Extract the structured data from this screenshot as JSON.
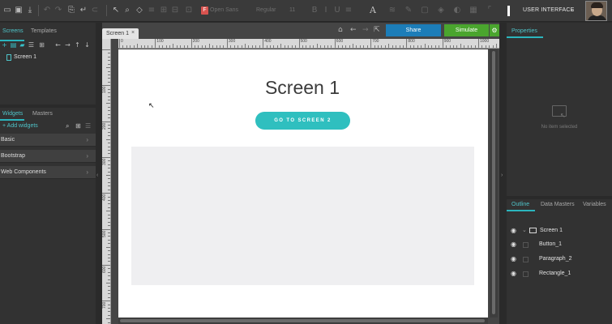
{
  "toolbar": {
    "font_badge": "F",
    "font_family": "Open Sans",
    "font_style": "Regular",
    "font_size": "11",
    "text_glyph": "A",
    "project_name": "USER INTERFACE"
  },
  "left_panel": {
    "tabs": [
      "Screens",
      "Templates"
    ],
    "screens": [
      {
        "label": "Screen 1"
      }
    ],
    "widget_tabs": [
      "Widgets",
      "Masters"
    ],
    "add_widgets_label": "Add widgets",
    "libraries": [
      {
        "label": "Basic"
      },
      {
        "label": "Bootstrap"
      },
      {
        "label": "Web Components"
      }
    ]
  },
  "canvas": {
    "tab_label": "Screen 1",
    "share_label": "Share",
    "simulate_label": "Simulate",
    "ruler_h": [
      "0",
      "100",
      "200",
      "300",
      "400",
      "500",
      "600",
      "700",
      "800",
      "900",
      "1000"
    ],
    "ruler_v": [
      "100",
      "200",
      "300",
      "400",
      "500",
      "600",
      "700"
    ],
    "screen_title": "Screen 1",
    "cta_label": "GO TO SCREEN 2"
  },
  "right_panel": {
    "tab_label": "Properties",
    "empty_text": "No item selected",
    "outline_tabs": [
      "Outline",
      "Data Masters",
      "Variables"
    ],
    "outline": [
      {
        "label": "Screen 1"
      },
      {
        "label": "Button_1"
      },
      {
        "label": "Paragraph_2"
      },
      {
        "label": "Rectangle_1"
      }
    ]
  },
  "colors": {
    "accent": "#2bb5bd",
    "share": "#1c7db8",
    "simulate": "#4aa52e"
  }
}
